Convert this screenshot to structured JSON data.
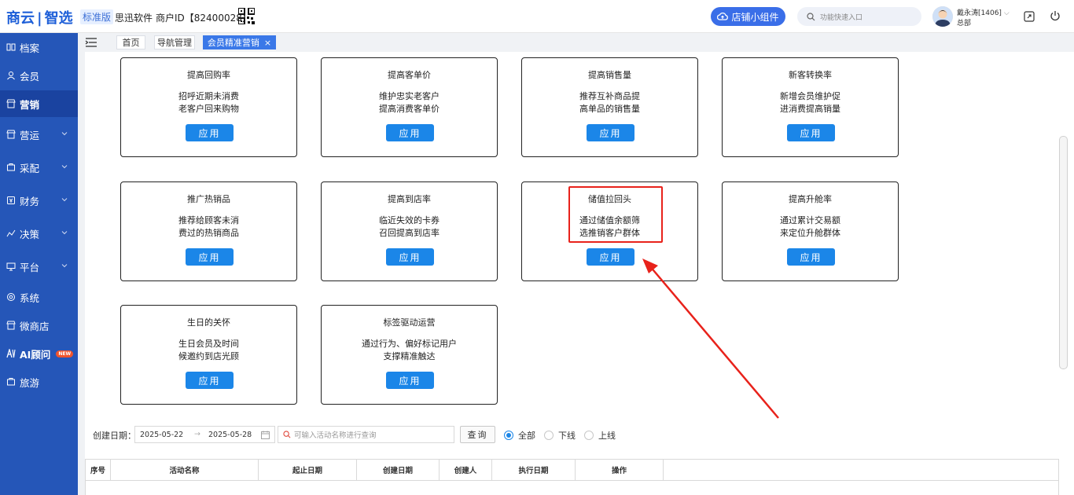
{
  "header": {
    "logo_left": "商云",
    "logo_right": "智选",
    "edition": "标准版",
    "company": "思迅软件",
    "merchant_id": "商户ID【82400028】",
    "shop_widget_label": "店铺小组件",
    "search_placeholder": "功能快速入口",
    "user_name": "戴永涛[1406]",
    "user_dept": "总部"
  },
  "sidebar": {
    "items": [
      {
        "label": "档案"
      },
      {
        "label": "会员"
      },
      {
        "label": "营销"
      },
      {
        "label": "营运"
      },
      {
        "label": "采配"
      },
      {
        "label": "财务"
      },
      {
        "label": "决策"
      },
      {
        "label": "平台"
      },
      {
        "label": "系统"
      },
      {
        "label": "微商店"
      },
      {
        "label": "AI顾问"
      },
      {
        "label": "旅游"
      }
    ],
    "new_badge": "NEW"
  },
  "tabs": [
    {
      "label": "首页"
    },
    {
      "label": "导航管理"
    },
    {
      "label": "会员精准营销"
    }
  ],
  "cards": [
    {
      "title": "提高回购率",
      "line1": "招呼近期未消费",
      "line2": "老客户回来购物",
      "button": "应用"
    },
    {
      "title": "提高客单价",
      "line1": "维护忠实老客户",
      "line2": "提高消费客单价",
      "button": "应用"
    },
    {
      "title": "提高销售量",
      "line1": "推荐互补商品提",
      "line2": "高单品的销售量",
      "button": "应用"
    },
    {
      "title": "新客转换率",
      "line1": "新增会员维护促",
      "line2": "进消费提高销量",
      "button": "应用"
    },
    {
      "title": "推广热销品",
      "line1": "推荐给顾客未消",
      "line2": "费过的热销商品",
      "button": "应用"
    },
    {
      "title": "提高到店率",
      "line1": "临近失效的卡券",
      "line2": "召回提高到店率",
      "button": "应用"
    },
    {
      "title": "储值拉回头",
      "line1": "通过储值余额筛",
      "line2": "选推销客户群体",
      "button": "应用"
    },
    {
      "title": "提高升舱率",
      "line1": "通过累计交易额",
      "line2": "来定位升舱群体",
      "button": "应用"
    },
    {
      "title": "生日的关怀",
      "line1": "生日会员及时间",
      "line2": "候邀约到店光顾",
      "button": "应用"
    },
    {
      "title": "标签驱动运营",
      "line1": "通过行为、偏好标记用户",
      "line2": "支撑精准触达",
      "button": "应用"
    }
  ],
  "filter": {
    "label": "创建日期：",
    "date_start": "2025-05-22",
    "date_arrow": "→",
    "date_end": "2025-05-28",
    "name_placeholder": "可输入活动名称进行查询",
    "query_button": "查询",
    "radio_all": "全部",
    "radio_offline": "下线",
    "radio_online": "上线"
  },
  "table": {
    "columns": [
      "序号",
      "活动名称",
      "起止日期",
      "创建日期",
      "创建人",
      "执行日期",
      "操作"
    ]
  },
  "colors": {
    "sidebar_bg": "#2556b8",
    "accent": "#1b86e8",
    "highlight": "#e8221b"
  }
}
